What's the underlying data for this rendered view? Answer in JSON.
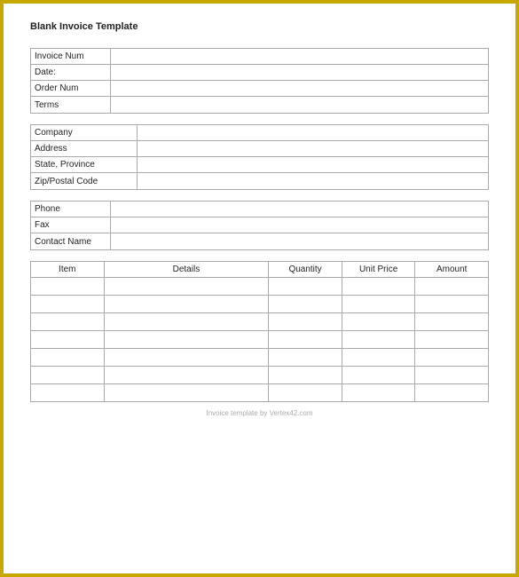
{
  "page": {
    "title": "Blank Invoice Template"
  },
  "info_section": {
    "fields": [
      {
        "label": "Invoice Num",
        "value": ""
      },
      {
        "label": "Date:",
        "value": ""
      },
      {
        "label": "Order Num",
        "value": ""
      },
      {
        "label": "Terms",
        "value": ""
      }
    ]
  },
  "company_section": {
    "fields": [
      {
        "label": "Company",
        "value": ""
      },
      {
        "label": "Address",
        "value": ""
      },
      {
        "label": "State, Province",
        "value": ""
      },
      {
        "label": "Zip/Postal Code",
        "value": ""
      }
    ]
  },
  "contact_section": {
    "fields": [
      {
        "label": "Phone",
        "value": ""
      },
      {
        "label": "Fax",
        "value": ""
      },
      {
        "label": "Contact Name",
        "value": ""
      }
    ]
  },
  "table": {
    "headers": [
      "Item",
      "Details",
      "Quantity",
      "Unit Price",
      "Amount"
    ],
    "rows": [
      [
        "",
        "",
        "",
        "",
        ""
      ],
      [
        "",
        "",
        "",
        "",
        ""
      ],
      [
        "",
        "",
        "",
        "",
        ""
      ],
      [
        "",
        "",
        "",
        "",
        ""
      ],
      [
        "",
        "",
        "",
        "",
        ""
      ],
      [
        "",
        "",
        "",
        "",
        ""
      ],
      [
        "",
        "",
        "",
        "",
        ""
      ]
    ]
  },
  "footer": {
    "text": "Invoice template by Vertex42.com"
  }
}
